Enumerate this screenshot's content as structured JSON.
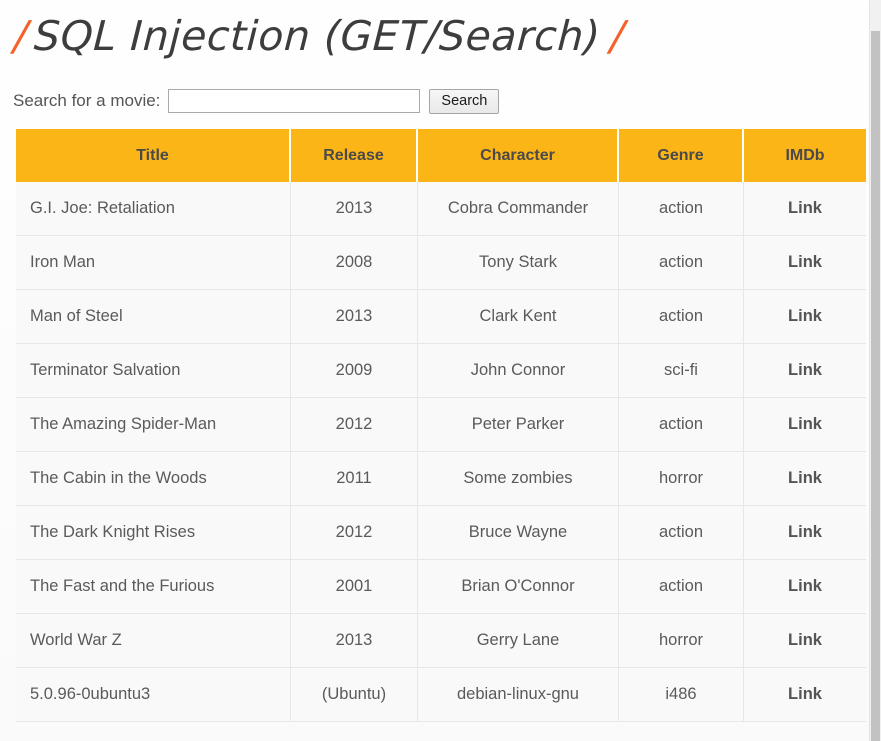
{
  "page": {
    "title_slash_left": "/",
    "title": "SQL Injection (GET/Search)",
    "title_slash_right": "/",
    "accent_color": "#f4622a",
    "header_bg_color": "#fcb517",
    "text_color": "#5a5a5a"
  },
  "search": {
    "label": "Search for a movie:",
    "value": "",
    "placeholder": "",
    "button_label": "Search"
  },
  "table": {
    "columns": [
      "Title",
      "Release",
      "Character",
      "Genre",
      "IMDb"
    ],
    "rows": [
      {
        "title": "G.I. Joe: Retaliation",
        "release": "2013",
        "character": "Cobra Commander",
        "genre": "action",
        "imdb": "Link"
      },
      {
        "title": "Iron Man",
        "release": "2008",
        "character": "Tony Stark",
        "genre": "action",
        "imdb": "Link"
      },
      {
        "title": "Man of Steel",
        "release": "2013",
        "character": "Clark Kent",
        "genre": "action",
        "imdb": "Link"
      },
      {
        "title": "Terminator Salvation",
        "release": "2009",
        "character": "John Connor",
        "genre": "sci-fi",
        "imdb": "Link"
      },
      {
        "title": "The Amazing Spider-Man",
        "release": "2012",
        "character": "Peter Parker",
        "genre": "action",
        "imdb": "Link"
      },
      {
        "title": "The Cabin in the Woods",
        "release": "2011",
        "character": "Some zombies",
        "genre": "horror",
        "imdb": "Link"
      },
      {
        "title": "The Dark Knight Rises",
        "release": "2012",
        "character": "Bruce Wayne",
        "genre": "action",
        "imdb": "Link"
      },
      {
        "title": "The Fast and the Furious",
        "release": "2001",
        "character": "Brian O'Connor",
        "genre": "action",
        "imdb": "Link"
      },
      {
        "title": "World War Z",
        "release": "2013",
        "character": "Gerry Lane",
        "genre": "horror",
        "imdb": "Link"
      },
      {
        "title": "5.0.96-0ubuntu3",
        "release": "(Ubuntu)",
        "character": "debian-linux-gnu",
        "genre": "i486",
        "imdb": "Link"
      }
    ]
  }
}
